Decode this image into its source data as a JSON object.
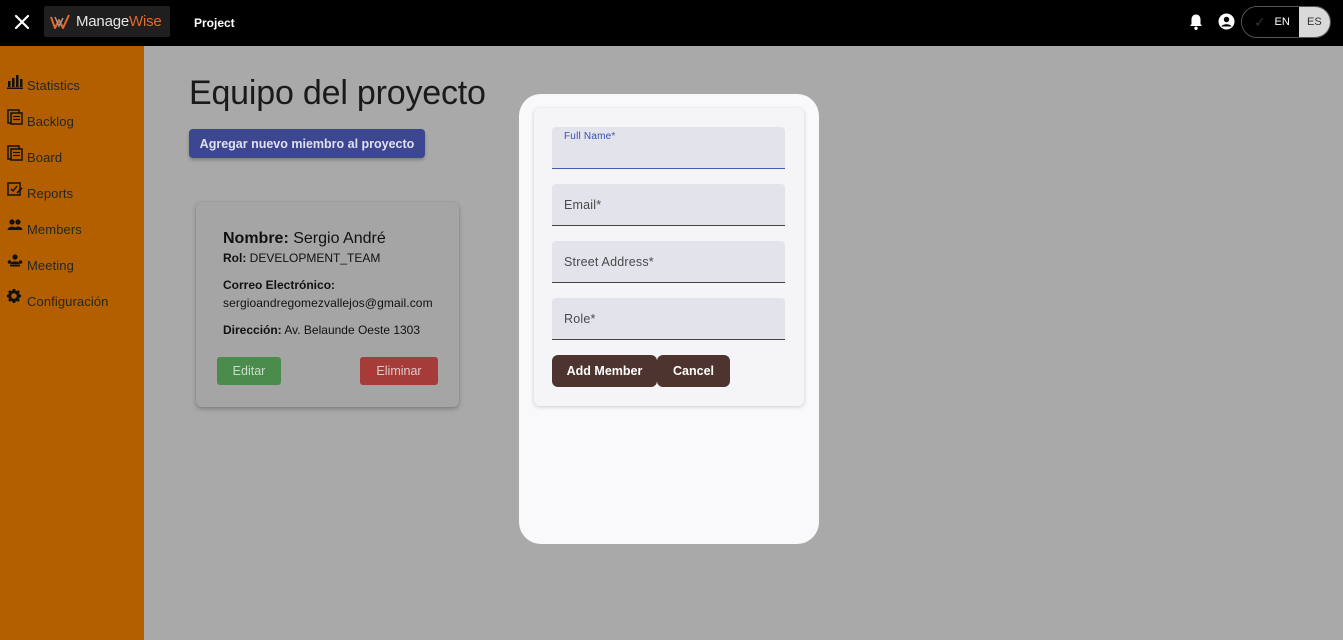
{
  "topbar": {
    "logo_prefix": "Manage",
    "logo_suffix": "Wise",
    "project_link": "Project",
    "lang_en": "EN",
    "lang_es": "ES",
    "lang_selected": "ES"
  },
  "sidebar": {
    "items": [
      {
        "label": "Statistics",
        "icon": "statistics-icon"
      },
      {
        "label": "Backlog",
        "icon": "backlog-icon"
      },
      {
        "label": "Board",
        "icon": "board-icon"
      },
      {
        "label": "Reports",
        "icon": "reports-icon"
      },
      {
        "label": "Members",
        "icon": "members-icon"
      },
      {
        "label": "Meeting",
        "icon": "meeting-icon"
      },
      {
        "label": "Configuración",
        "icon": "gear-icon"
      }
    ]
  },
  "main": {
    "title": "Equipo del proyecto",
    "add_member_label": "Agregar nuevo miembro al proyecto",
    "card": {
      "name_label": "Nombre:",
      "name": "Sergio André",
      "role_label": "Rol:",
      "role": "DEVELOPMENT_TEAM",
      "email_label": "Correo Electrónico:",
      "email": "sergioandregomezvallejos@gmail.com",
      "address_label": "Dirección:",
      "address": "Av. Belaunde Oeste 1303",
      "edit_label": "Editar",
      "delete_label": "Eliminar"
    }
  },
  "modal": {
    "fields": [
      {
        "label": "Full Name*",
        "value": ""
      },
      {
        "label": "Email*",
        "value": ""
      },
      {
        "label": "Street Address*",
        "value": ""
      },
      {
        "label": "Role*",
        "value": ""
      }
    ],
    "submit_label": "Add Member",
    "cancel_label": "Cancel"
  },
  "colors": {
    "topbar": "#000000",
    "sidebar": "#b35f00",
    "primary_button": "#3d4691",
    "edit_button": "#4a8c4c",
    "delete_button": "#a63c3a",
    "modal_button": "#4e342e",
    "logo_accent": "#e4692c"
  }
}
